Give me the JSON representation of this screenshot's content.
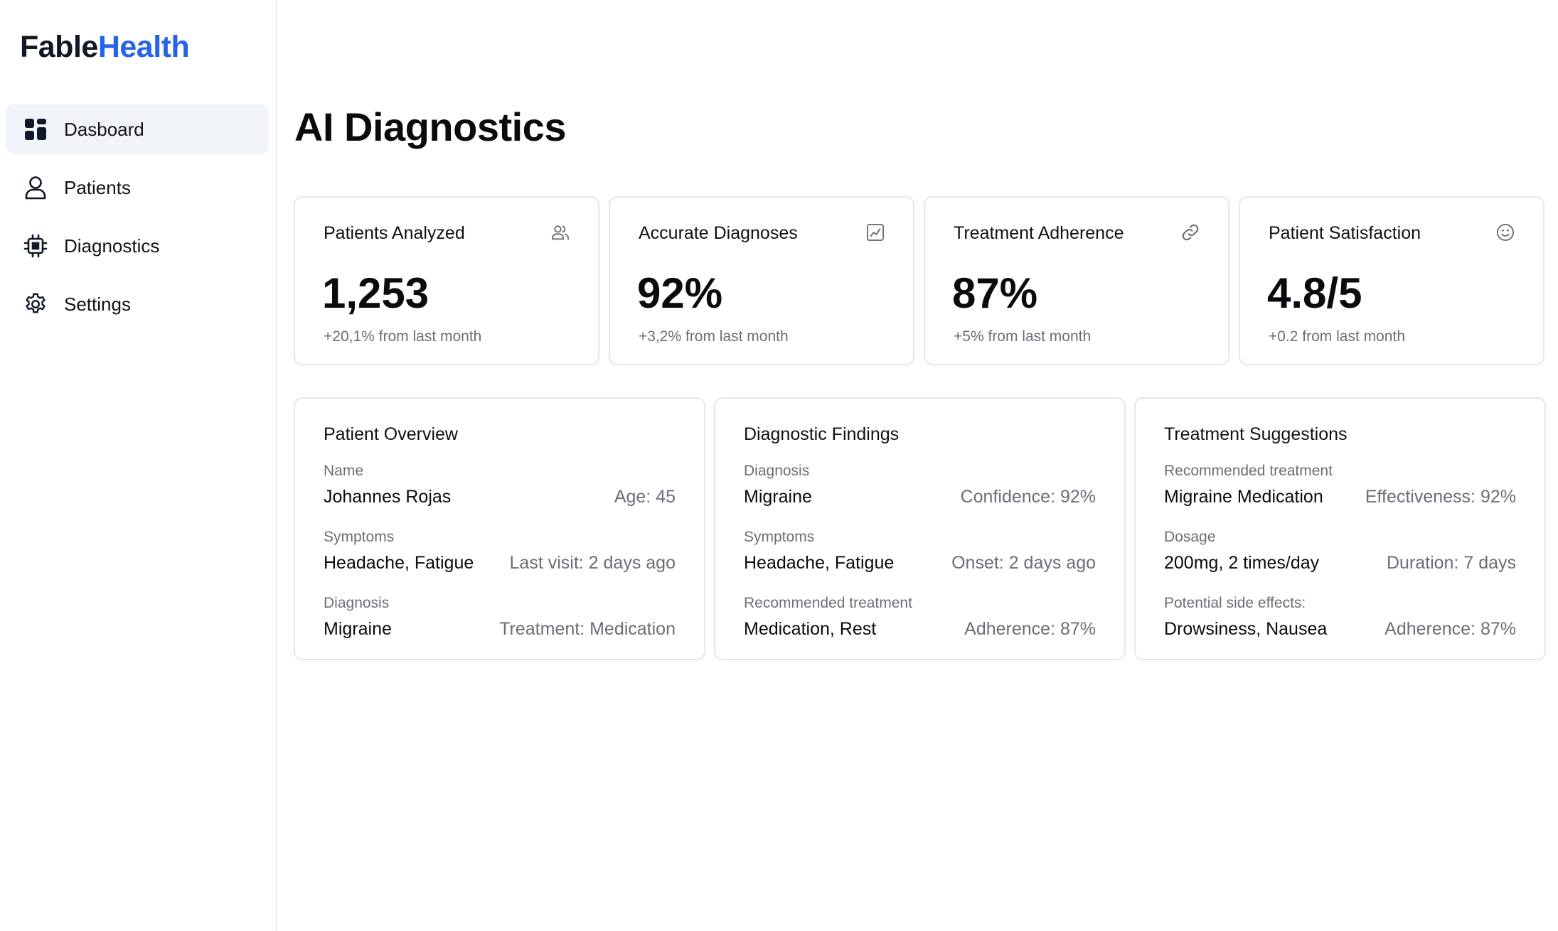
{
  "brand": {
    "part1": "Fable",
    "part2": "Health"
  },
  "sidebar": {
    "items": [
      {
        "label": "Dasboard",
        "icon": "dashboard-icon",
        "active": true
      },
      {
        "label": "Patients",
        "icon": "user-icon"
      },
      {
        "label": "Diagnostics",
        "icon": "chip-icon"
      },
      {
        "label": "Settings",
        "icon": "gear-icon"
      }
    ]
  },
  "page": {
    "title": "AI Diagnostics"
  },
  "stats": [
    {
      "title": "Patients Analyzed",
      "value": "1,253",
      "sub": "+20,1% from last month",
      "icon": "users-icon"
    },
    {
      "title": "Accurate Diagnoses",
      "value": "92%",
      "sub": "+3,2% from last month",
      "icon": "chart-line-icon"
    },
    {
      "title": "Treatment Adherence",
      "value": "87%",
      "sub": "+5% from last month",
      "icon": "link-icon"
    },
    {
      "title": "Patient Satisfaction",
      "value": "4.8/5",
      "sub": "+0.2 from last month",
      "icon": "smile-icon"
    }
  ],
  "cards": [
    {
      "title": "Patient Overview",
      "rows": [
        {
          "label": "Name",
          "value": "Johannes Rojas",
          "meta": "Age: 45"
        },
        {
          "label": "Symptoms",
          "value": "Headache, Fatigue",
          "meta": "Last visit: 2 days ago"
        },
        {
          "label": "Diagnosis",
          "value": "Migraine",
          "meta": "Treatment: Medication"
        }
      ]
    },
    {
      "title": "Diagnostic Findings",
      "rows": [
        {
          "label": "Diagnosis",
          "value": "Migraine",
          "meta": "Confidence: 92%"
        },
        {
          "label": "Symptoms",
          "value": "Headache, Fatigue",
          "meta": "Onset: 2 days ago"
        },
        {
          "label": "Recommended treatment",
          "value": "Medication, Rest",
          "meta": "Adherence: 87%"
        }
      ]
    },
    {
      "title": "Treatment Suggestions",
      "rows": [
        {
          "label": "Recommended treatment",
          "value": "Migraine Medication",
          "meta": "Effectiveness: 92%"
        },
        {
          "label": "Dosage",
          "value": "200mg, 2 times/day",
          "meta": "Duration: 7 days"
        },
        {
          "label": "Potential side effects:",
          "value": "Drowsiness, Nausea",
          "meta": "Adherence: 87%"
        }
      ]
    }
  ],
  "colors": {
    "brand_blue": "#2563eb",
    "active_nav_bg": "#f1f4f9",
    "muted_text": "#6b6e76",
    "border": "#e5e7eb"
  }
}
